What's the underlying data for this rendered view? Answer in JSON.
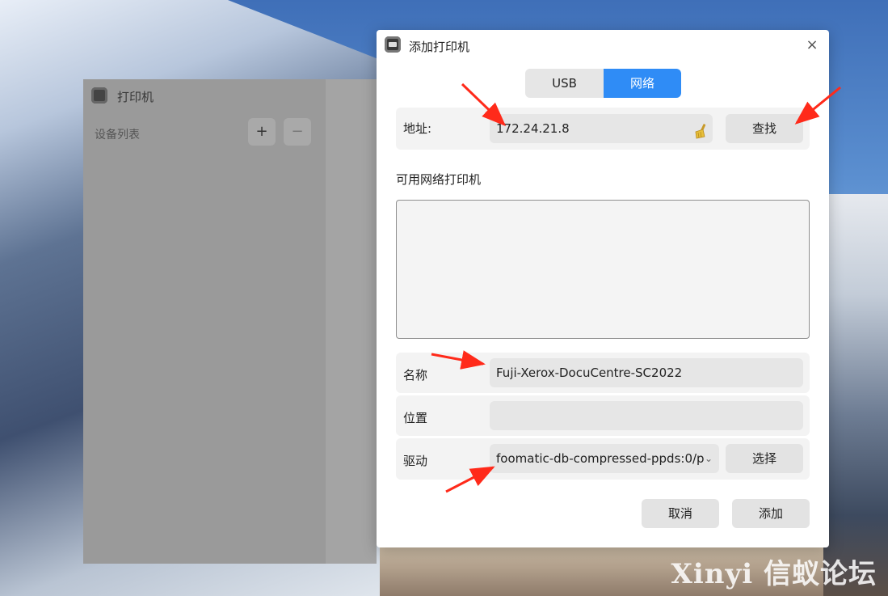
{
  "background_window": {
    "title": "打印机",
    "device_list_label": "设备列表",
    "add_symbol": "+",
    "remove_symbol": "−"
  },
  "dialog": {
    "title": "添加打印机",
    "close_symbol": "×",
    "tabs": [
      {
        "label": "USB",
        "selected": false
      },
      {
        "label": "网络",
        "selected": true
      }
    ],
    "address": {
      "label": "地址:",
      "value": "172.24.21.8",
      "clear_icon": "broom-icon"
    },
    "find_button": "查找",
    "available_printers_title": "可用网络打印机",
    "available_printers": [],
    "name": {
      "label": "名称",
      "value": "Fuji-Xerox-DocuCentre-SC2022"
    },
    "location": {
      "label": "位置",
      "value": ""
    },
    "driver": {
      "label": "驱动",
      "value": "foomatic-db-compressed-ppds:0/p"
    },
    "choose_button": "选择",
    "cancel_button": "取消",
    "add_button": "添加"
  },
  "watermark": "Xinyi 信蚁论坛",
  "colors": {
    "accent": "#2f8cf6",
    "annotation_arrow": "#ff2a1a"
  }
}
